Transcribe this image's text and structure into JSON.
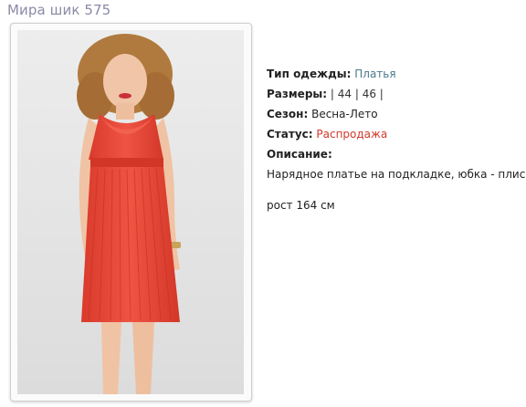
{
  "title": "Мира шик 575",
  "product": {
    "type_label": "Тип одежды:",
    "type_value": "Платья",
    "sizes_label": "Размеры:",
    "sizes_value": "| 44 | 46 |",
    "season_label": "Сезон:",
    "season_value": "Весна-Лето",
    "status_label": "Статус:",
    "status_value": "Распродажа",
    "description_label": "Описание:",
    "description_text": "Нарядное платье на подкладке, юбка - плиссе",
    "height_text": "рост 164 см"
  },
  "colors": {
    "link": "#4a7a8c",
    "sale": "#d03a2a",
    "dress": "#e8483a",
    "title": "#8a8aa8"
  }
}
